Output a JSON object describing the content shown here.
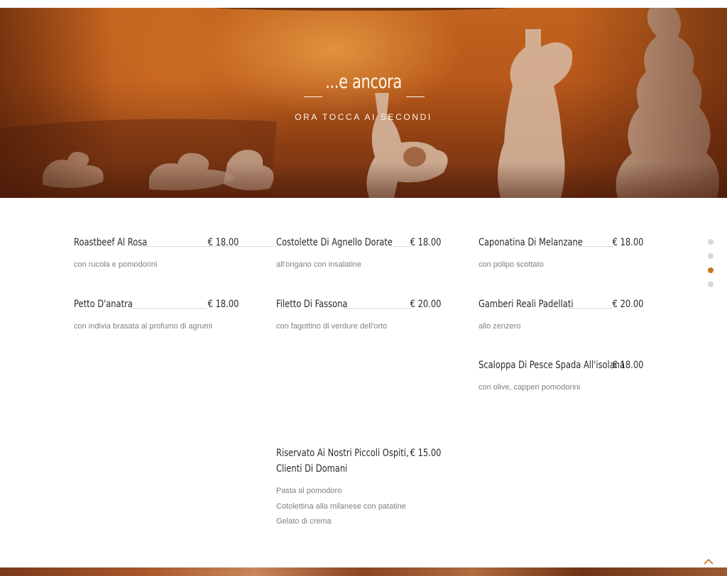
{
  "hero": {
    "title": "...e ancora",
    "subtitle": "ORA TOCCA AI SECONDI"
  },
  "menu": {
    "items": [
      {
        "name": "Roastbeef Al Rosa",
        "price": "€ 18.00",
        "description": "con rucola e pomodorini"
      },
      {
        "name": "Costolette Di Agnello Dorate",
        "price": "€ 18.00",
        "description": "all'origano con insalatine"
      },
      {
        "name": "Caponatina Di Melanzane",
        "price": "€ 18.00",
        "description": "con polipo scottato"
      },
      {
        "name": "Petto D'anatra",
        "price": "€ 18.00",
        "description": "con indivia brasata al profumo di agrumi"
      },
      {
        "name": "Filetto Di Fassona",
        "price": "€ 20.00",
        "description": "con fagottino di verdure dell'orto"
      },
      {
        "name": "Gamberi Reali Padellati",
        "price": "€ 20.00",
        "description": "allo zenzero"
      },
      {
        "name": "Scaloppa Di Pesce Spada All'isolana",
        "price": "€ 18.00",
        "description": "con olive, capperi pomodorini"
      }
    ],
    "kids": {
      "name_line1": "Riservato Ai Nostri Piccoli Ospiti,",
      "name_line2": "Clienti Di Domani",
      "price": "€ 15.00",
      "lines": [
        "Pasta al pomodoro",
        "Cotolettina alla milanese con patatine",
        "Gelato di crema"
      ]
    }
  },
  "pager": {
    "count": 4,
    "active": 3
  },
  "colors": {
    "accent": "#c9781e",
    "text": "#2a2a2a",
    "muted": "#808080"
  },
  "icons": {
    "scroll_top": "chevron-up-icon"
  }
}
